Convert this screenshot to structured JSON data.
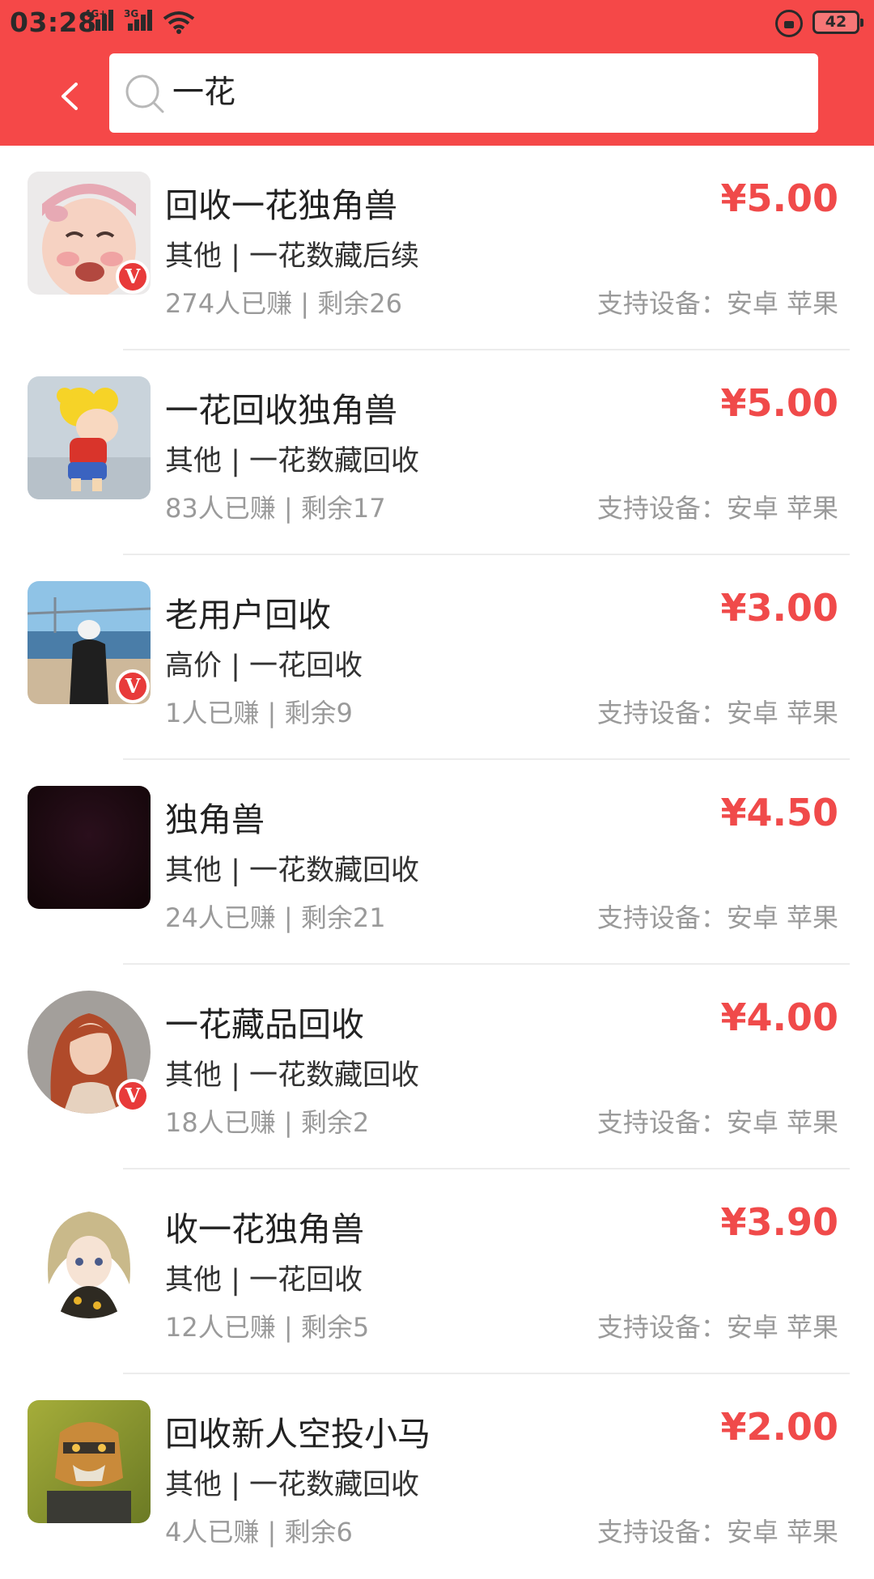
{
  "status_bar": {
    "time": "03:28",
    "network_1": "4G+",
    "network_2": "3G",
    "battery": "42"
  },
  "search": {
    "query": "一花"
  },
  "colors": {
    "header": "#f54848",
    "price": "#f04a4a",
    "badge": "#e83a3a"
  },
  "items": [
    {
      "title": "回收一花独角兽",
      "price": "¥5.00",
      "category": "其他 | 一花数藏后续",
      "earned": "274人已赚",
      "remaining": "剩余26",
      "devices": "支持设备：安卓 苹果",
      "avatar": "crying-baby",
      "verified": true
    },
    {
      "title": "一花回收独角兽",
      "price": "¥5.00",
      "category": "其他 | 一花数藏回收",
      "earned": "83人已赚",
      "remaining": "剩余17",
      "devices": "支持设备：安卓 苹果",
      "avatar": "cartoon-boy",
      "verified": false
    },
    {
      "title": "老用户回收",
      "price": "¥3.00",
      "category": "高价 | 一花回收",
      "earned": "1人已赚",
      "remaining": "剩余9",
      "devices": "支持设备：安卓 苹果",
      "avatar": "beach-person",
      "verified": true
    },
    {
      "title": "独角兽",
      "price": "¥4.50",
      "category": "其他 | 一花数藏回收",
      "earned": "24人已赚",
      "remaining": "剩余21",
      "devices": "支持设备：安卓 苹果",
      "avatar": "dark-square",
      "verified": false
    },
    {
      "title": "一花藏品回收",
      "price": "¥4.00",
      "category": "其他 | 一花数藏回收",
      "earned": "18人已赚",
      "remaining": "剩余2",
      "devices": "支持设备：安卓 苹果",
      "avatar": "red-hair-girl",
      "verified": true
    },
    {
      "title": "收一花独角兽",
      "price": "¥3.90",
      "category": "其他 | 一花回收",
      "earned": "12人已赚",
      "remaining": "剩余5",
      "devices": "支持设备：安卓 苹果",
      "avatar": "anime-girl",
      "verified": false
    },
    {
      "title": "回收新人空投小马",
      "price": "¥2.00",
      "category": "其他 | 一花数藏回收",
      "earned": "4人已赚",
      "remaining": "剩余6",
      "devices": "支持设备：安卓 苹果",
      "avatar": "robot-tiger",
      "verified": false
    }
  ]
}
